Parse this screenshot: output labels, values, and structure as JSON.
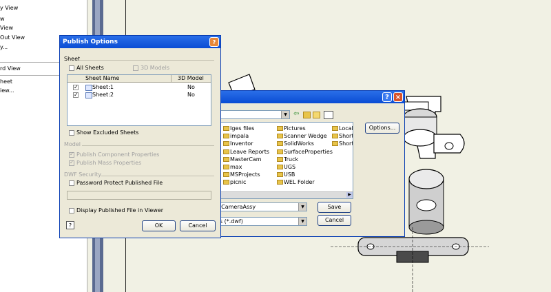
{
  "left_menu": {
    "items": [
      "y View",
      "w",
      "View",
      "Out View",
      "y...",
      "rd View",
      "heet",
      "iew..."
    ]
  },
  "publish": {
    "title": "Publish Options",
    "sheet_group": "Sheet",
    "all_sheets": "All Sheets",
    "3d_models": "3D Models",
    "col_sheet_name": "Sheet Name",
    "col_3d_model": "3D Model",
    "sheets": [
      {
        "name": "Sheet:1",
        "model": "No",
        "checked": true
      },
      {
        "name": "Sheet:2",
        "model": "No",
        "checked": true
      }
    ],
    "show_excluded": "Show Excluded Sheets",
    "model_group": "Model",
    "publish_component": "Publish Component Properties",
    "publish_mass": "Publish Mass Properties",
    "dwf_group": "DWF Security",
    "password_protect": "Password Protect Published File",
    "display_in_viewer": "Display Published File in Viewer",
    "ok": "OK",
    "cancel": "Cancel",
    "help": "?"
  },
  "save_dialog": {
    "folders_col1": [
      "Iges files",
      "impala",
      "Inventor",
      "Leave Reports",
      "MasterCam",
      "max",
      "MSProjects",
      "picnic"
    ],
    "folders_col2": [
      "Pictures",
      "Scanner Wedge",
      "SolidWorks",
      "SurfaceProperties",
      "Truck",
      "UGS",
      "USB",
      "WEL Folder"
    ],
    "folders_col3": [
      "Local",
      "Short",
      "Short"
    ],
    "options_button": "Options...",
    "filename": "leCameraAssy",
    "filetype": "es (*.dwf)",
    "save": "Save",
    "cancel": "Cancel",
    "help": "?",
    "close": "×"
  },
  "colors": {
    "xp_title": "#0a4cd4",
    "dialog_bg": "#ece9d8",
    "canvas_bg": "#f1f1e4"
  }
}
